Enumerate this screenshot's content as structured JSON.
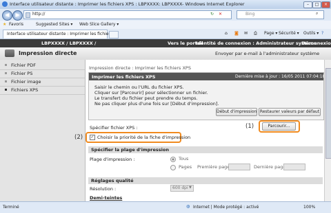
{
  "browser": {
    "window_title": "Interface utilisateur distante : Imprimer les fichiers XPS : LBPXXXX: LBPXXXX- Windows Internet Explorer",
    "url": "http://",
    "search_placeholder": "Bing",
    "favorites_label": "Favoris",
    "fav_items": [
      "Suggested Sites ▾",
      "Web Slice Gallery ▾"
    ],
    "tab_title": "Interface utilisateur distante : Imprimer les fichiers ...",
    "toolbar_items": [
      "Page ▾",
      "Sécurité ▾",
      "Outils ▾"
    ],
    "status_left": "Terminé",
    "status_zone": "Internet | Mode protégé : activé",
    "zoom": "100%"
  },
  "header": {
    "device": "LBPXXXX / LBPXXXX /",
    "portal_link": "Vers le portail",
    "login": "Identité de connexion : Administrateur système",
    "logout": "Déconnexion",
    "app_title": "Impression directe",
    "mail_link": "Envoyer par e-mail à l'administrateur système"
  },
  "sidebar": {
    "items": [
      {
        "label": "Fichier PDF"
      },
      {
        "label": "Fichier PS"
      },
      {
        "label": "Fichier image"
      },
      {
        "label": "Fichiers XPS"
      }
    ]
  },
  "main": {
    "breadcrumb": "Impression directe : Imprimer les fichiers XPS",
    "panel_title": "Imprimer les fichiers XPS",
    "last_update": "Dernière mise à jour : 16/05 2011 07:04:18",
    "instructions": [
      "Saisir le chemin ou l'URL du fichier XPS.",
      "Cliquer sur [Parcourir] pour sélectionner un fichier.",
      "Le transfert du fichier peut prendre du temps.",
      "Ne pas cliquer plus d'une fois sur [Début d'impression]."
    ],
    "start_button": "Début d'impression",
    "restore_button": "Restaurer valeurs par défaut",
    "file_label": "Spécifier fichier XPS :",
    "browse_button": "Parcourir...",
    "ticket_checkbox": "Choisir la priorité de la fiche d'impression",
    "callout1": "(1)",
    "callout2": "(2)",
    "range_section": "Spécifier la plage d'impression",
    "range_label": "Plage d'impression :",
    "range_all": "Tous",
    "range_pages": "Pages",
    "first_page": "Première page :",
    "last_page": "Dernière page :",
    "quality_section": "Réglages qualité",
    "resolution_label": "Résolution :",
    "resolution_value": "600 dpi",
    "halftone_section": "Demi-teintes"
  }
}
